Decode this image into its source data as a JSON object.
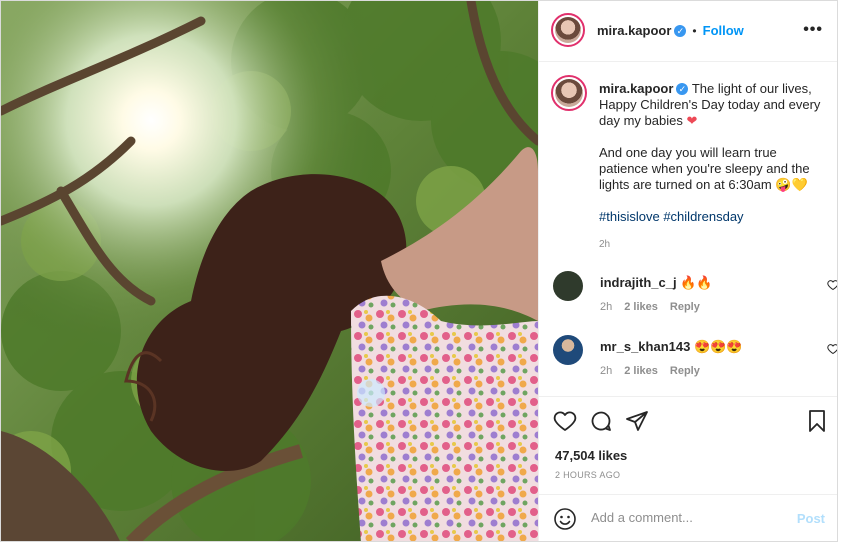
{
  "post": {
    "username": "mira.kapoor",
    "follow_label": "Follow",
    "separator": "•",
    "more_label": "•••",
    "caption_line1": "The light of our lives, Happy Children's Day today and every day my babies",
    "caption_emoji1": "❤",
    "caption_line2": "And one day you will learn true patience when you're sleepy and the lights are turned on at 6:30am",
    "caption_emoji2": "🤪💛",
    "hashtags": [
      "#thisislove",
      "#childrensday"
    ],
    "caption_time": "2h",
    "likes": "47,504 likes",
    "posted_ago": "2 HOURS AGO",
    "add_comment_placeholder": "Add a comment...",
    "post_label": "Post"
  },
  "comments": [
    {
      "username": "indrajith_c_j",
      "emoji": "🔥🔥",
      "time": "2h",
      "likes": "2 likes",
      "reply": "Reply"
    },
    {
      "username": "mr_s_khan143",
      "emoji": "😍😍😍",
      "time": "2h",
      "likes": "2 likes",
      "reply": "Reply"
    }
  ],
  "icons": {
    "verified": "verified-badge-icon",
    "like": "heart-icon",
    "comment": "comment-bubble-icon",
    "share": "paper-plane-icon",
    "save": "bookmark-icon",
    "emoji": "smiley-icon"
  },
  "colors": {
    "follow": "#0095f6",
    "post_disabled": "#b2dffc",
    "verified": "#3897f0",
    "hashtag": "#00376b",
    "meta": "#8e8e8e"
  }
}
